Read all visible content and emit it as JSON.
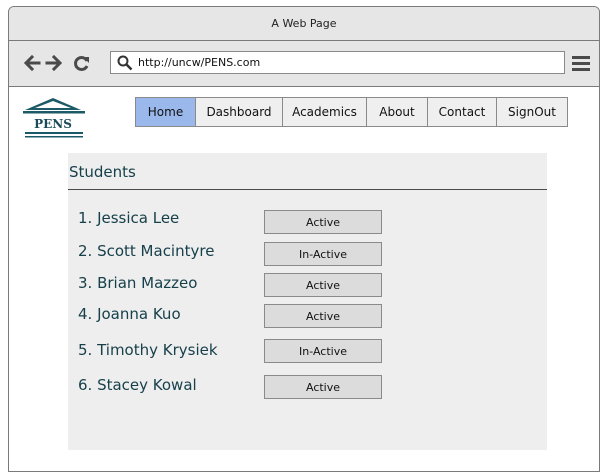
{
  "window": {
    "title": "A Web Page"
  },
  "browser": {
    "url": "http://uncw/PENS.com",
    "icons": {
      "back": "arrow-left-icon",
      "forward": "arrow-right-icon",
      "reload": "reload-icon",
      "search": "search-icon",
      "menu": "hamburger-menu-icon"
    }
  },
  "logo": {
    "text": "PENS"
  },
  "nav": {
    "tabs": [
      {
        "label": "Home",
        "active": true
      },
      {
        "label": "Dashboard",
        "active": false
      },
      {
        "label": "Academics",
        "active": false
      },
      {
        "label": "About",
        "active": false
      },
      {
        "label": "Contact",
        "active": false
      },
      {
        "label": "SignOut",
        "active": false
      }
    ]
  },
  "students": {
    "title": "Students",
    "items": [
      {
        "name": "1. Jessica Lee",
        "status": "Active"
      },
      {
        "name": "2. Scott Macintyre",
        "status": "In-Active"
      },
      {
        "name": "3. Brian Mazzeo",
        "status": "Active"
      },
      {
        "name": "4. Joanna Kuo",
        "status": "Active"
      },
      {
        "name": "5. Timothy Krysiek",
        "status": "In-Active"
      },
      {
        "name": "6. Stacey Kowal",
        "status": "Active"
      }
    ]
  },
  "colors": {
    "active_tab": "#9bb8ec",
    "text_primary": "#17404b",
    "chrome_bg": "#e6e6e6",
    "panel_bg": "#eeeeee"
  }
}
